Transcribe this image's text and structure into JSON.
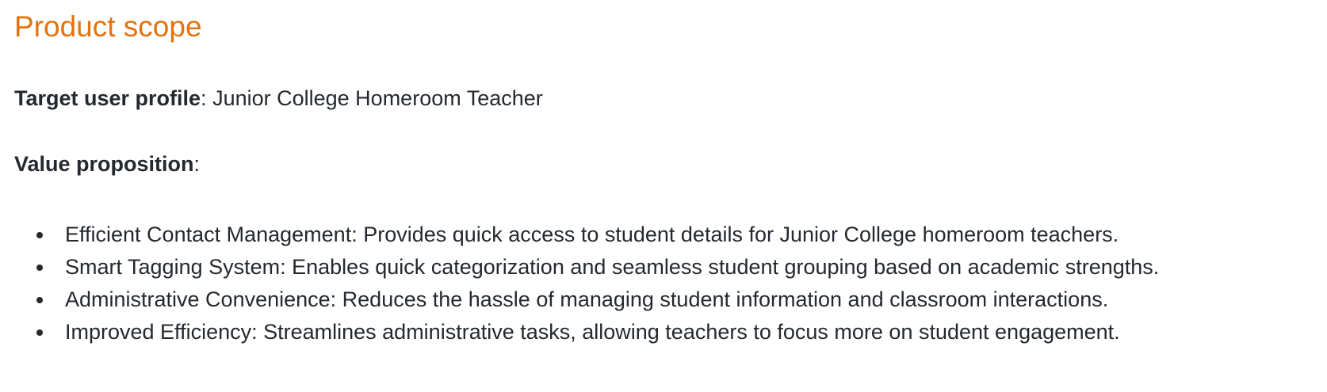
{
  "section": {
    "title": "Product scope"
  },
  "target_user": {
    "label": "Target user profile",
    "separator": ":",
    "value": " Junior College Homeroom Teacher"
  },
  "value_proposition": {
    "label": "Value proposition",
    "separator": ":",
    "items": [
      "Efficient Contact Management: Provides quick access to student details for Junior College homeroom teachers.",
      "Smart Tagging System: Enables quick categorization and seamless student grouping based on academic strengths.",
      "Administrative Convenience: Reduces the hassle of managing student information and classroom interactions.",
      "Improved Efficiency: Streamlines administrative tasks, allowing teachers to focus more on student engagement."
    ]
  },
  "colors": {
    "heading": "#e3730e",
    "text": "#24292f"
  }
}
